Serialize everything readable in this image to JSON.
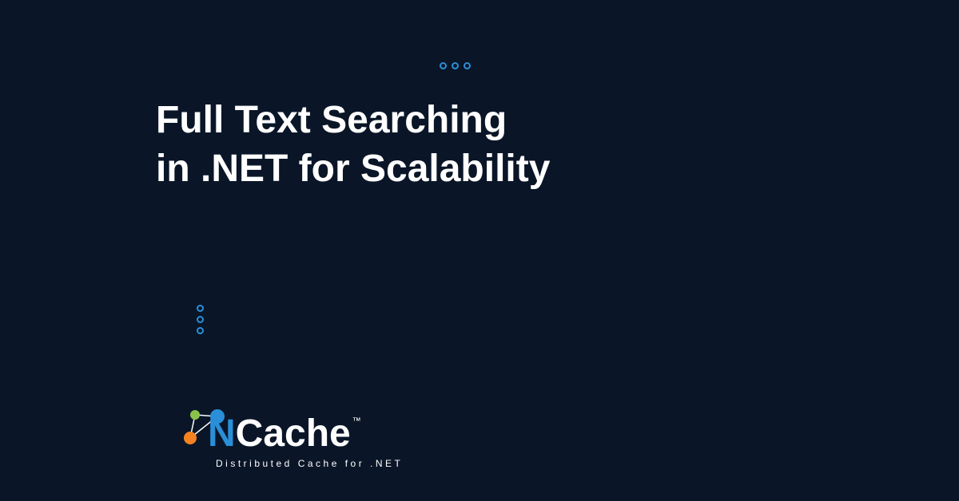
{
  "heading": {
    "line1": "Full Text Searching",
    "line2": "in .NET for Scalability"
  },
  "logo": {
    "letter_n": "N",
    "cache": "Cache",
    "tm": "™",
    "tagline": "Distributed  Cache  for  .NET"
  },
  "colors": {
    "background": "#0a1628",
    "accent_blue": "#2a8fd8",
    "orange": "#f58220",
    "green": "#8bc34a",
    "text": "#ffffff"
  }
}
